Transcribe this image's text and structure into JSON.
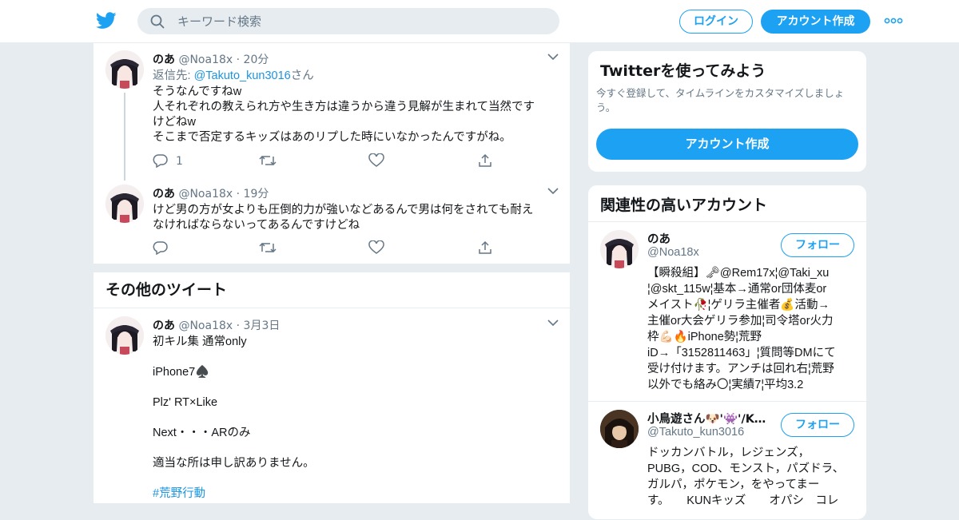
{
  "colors": {
    "accent": "#1da1f2",
    "link": "#1b95e0",
    "muted": "#657786",
    "background": "#e6ecf0"
  },
  "header": {
    "search_placeholder": "キーワード検索",
    "login_label": "ログイン",
    "signup_label": "アカウント作成"
  },
  "tweets": [
    {
      "name": "のあ",
      "handle": "@Noa18x",
      "time": "20分",
      "reply_prefix": "返信先: ",
      "reply_handle": "@Takuto_kun3016",
      "reply_suffix": "さん",
      "lines": [
        "そうなんですねw",
        "人それぞれの教えられ方や生き方は違うから違う見解が生まれて当然です",
        "けどねw",
        "そこまで否定するキッズはあのリプした時にいなかったんですがね。"
      ],
      "reply_count": "1"
    },
    {
      "name": "のあ",
      "handle": "@Noa18x",
      "time": "19分",
      "lines": [
        "けど男の方が女よりも圧倒的力が強いなどあるんで男は何をされても耐え",
        "なければならないってあるんですけどね"
      ]
    }
  ],
  "other_section_title": "その他のツイート",
  "other_tweet": {
    "name": "のあ",
    "handle": "@Noa18x",
    "time": "3月3日",
    "lines": [
      "初キル集 通常only",
      "iPhone7♠️",
      "Plz' RT×Like",
      "Next・・・ARのみ",
      "適当な所は申し訳ありません。"
    ],
    "hashtag": "#荒野行動"
  },
  "signup_card": {
    "title": "Twitterを使ってみよう",
    "subtitle": "今すぐ登録して、タイムラインをカスタマイズしましょう。",
    "button_label": "アカウント作成"
  },
  "related_card": {
    "title": "関連性の高いアカウント",
    "accounts": [
      {
        "name": "のあ",
        "handle": "@Noa18x",
        "follow_label": "フォロー",
        "bio_lines": [
          "【瞬殺組】🗝@Rem17x¦@Taki_xu",
          "¦@skt_115w¦基本→通常or団体麦or",
          "メイスト🥀¦ゲリラ主催者💰活動→",
          "主催or大会ゲリラ参加¦司令塔or火力",
          "枠💪🏻🔥iPhone勢¦荒野",
          "iD→「3152811463」¦質問等DMにて",
          "受け付けます。アンチは回れ右¦荒野",
          "以外でも絡み〇¦実績7¦平均3.2"
        ]
      },
      {
        "name": "小鳥遊さん🐶'👾'/KU…",
        "handle": "@Takuto_kun3016",
        "follow_label": "フォロー",
        "bio_lines": [
          "ドッカンバトル，レジェンズ，",
          "PUBG，COD、モンスト，パズドラ、",
          "ガルパ，ポケモン，をやってまー",
          "す。　　KUNキッズ　　オパシ　コレ"
        ]
      }
    ]
  }
}
